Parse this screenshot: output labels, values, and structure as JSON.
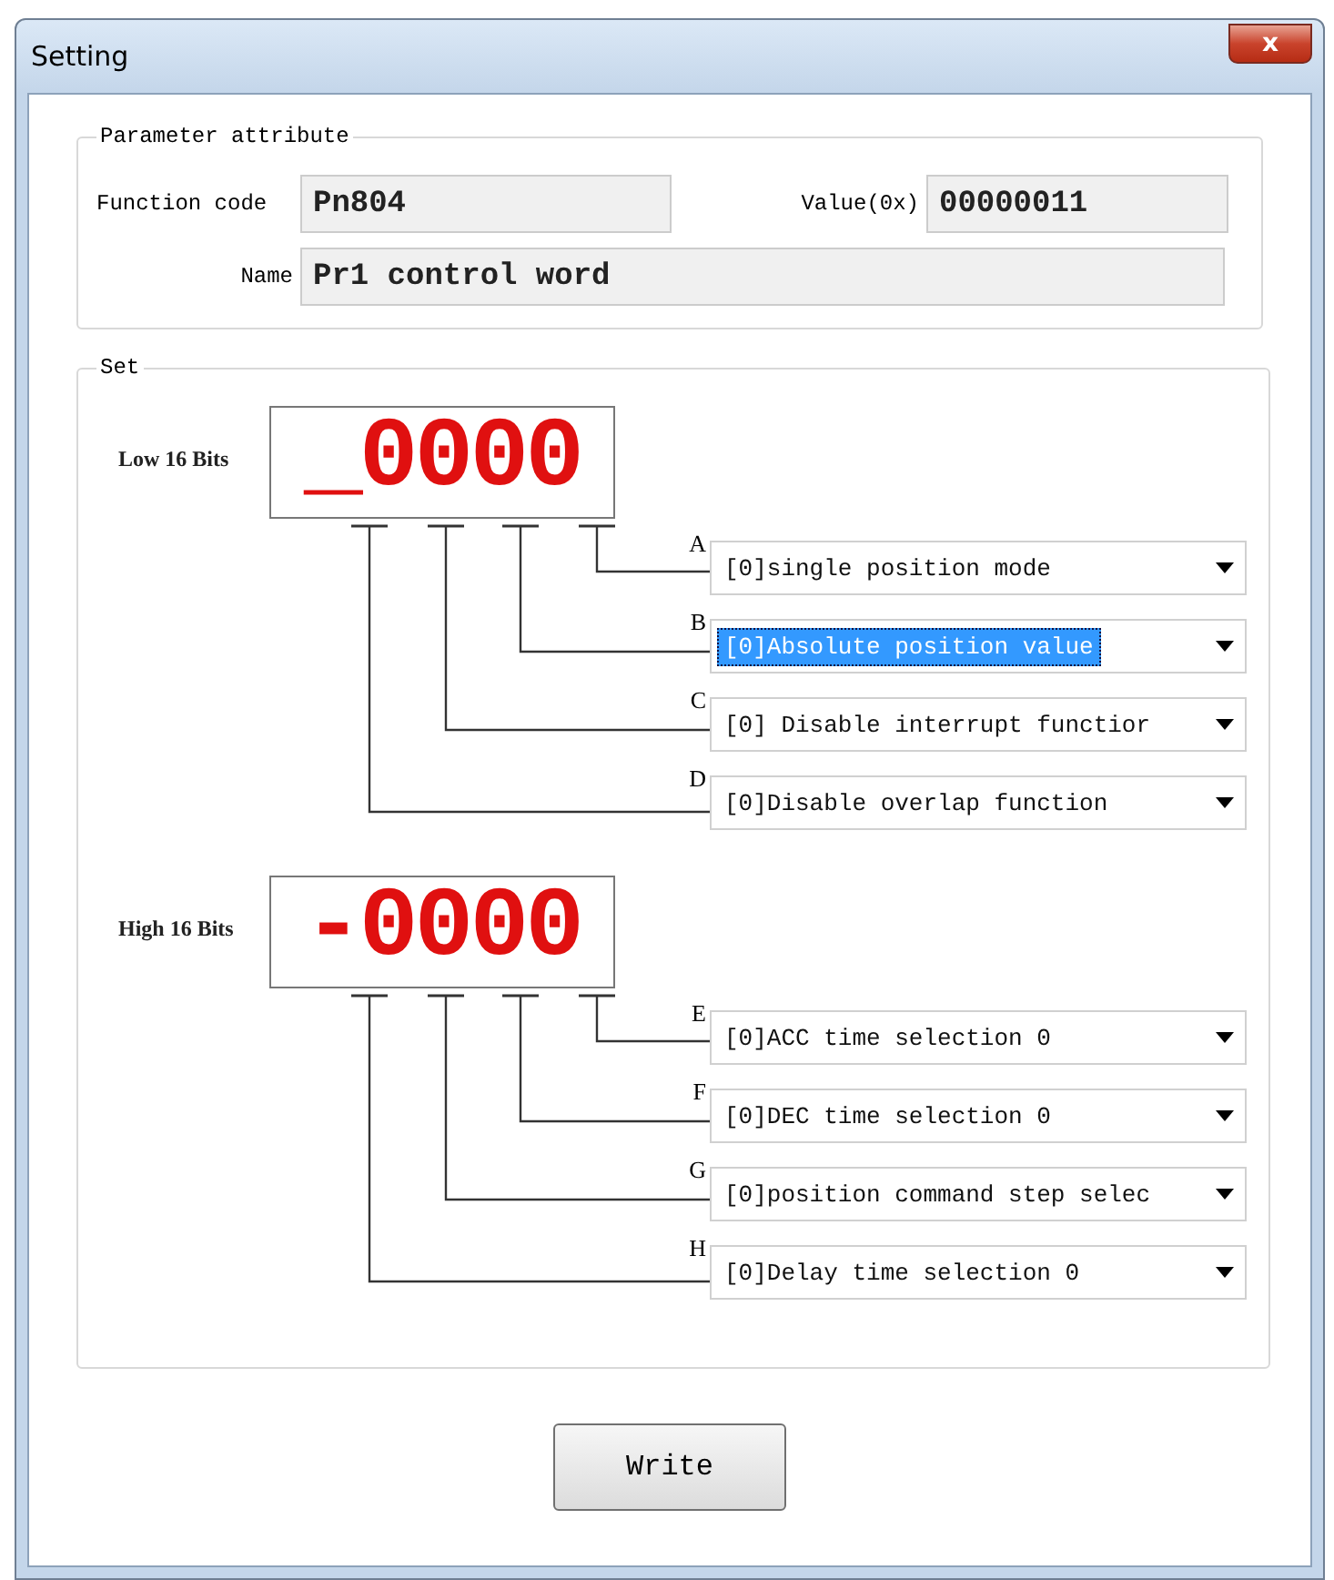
{
  "window": {
    "title": "Setting",
    "close": "x"
  },
  "parameter_attribute": {
    "title": "Parameter attribute",
    "function_code": {
      "label": "Function code",
      "value": "Pn804"
    },
    "value": {
      "label": "Value(0x)",
      "value": "00000011"
    },
    "name": {
      "label": "Name",
      "value": "Pr1 control word"
    }
  },
  "set": {
    "title": "Set",
    "blocks": [
      {
        "label": "Low 16 Bits",
        "display": "_0000",
        "rows": [
          {
            "letter": "A",
            "value": "[0]single position mode",
            "highlighted": false
          },
          {
            "letter": "B",
            "value": "[0]Absolute position value",
            "highlighted": true
          },
          {
            "letter": "C",
            "value": "[0] Disable interrupt functior",
            "highlighted": false
          },
          {
            "letter": "D",
            "value": "[0]Disable overlap function",
            "highlighted": false
          }
        ]
      },
      {
        "label": "High 16 Bits",
        "display": "-0000",
        "rows": [
          {
            "letter": "E",
            "value": "[0]ACC time selection 0",
            "highlighted": false
          },
          {
            "letter": "F",
            "value": "[0]DEC time selection 0",
            "highlighted": false
          },
          {
            "letter": "G",
            "value": "[0]position command step selec",
            "highlighted": false
          },
          {
            "letter": "H",
            "value": "[0]Delay time selection 0",
            "highlighted": false
          }
        ]
      }
    ]
  },
  "buttons": [
    "Write"
  ]
}
